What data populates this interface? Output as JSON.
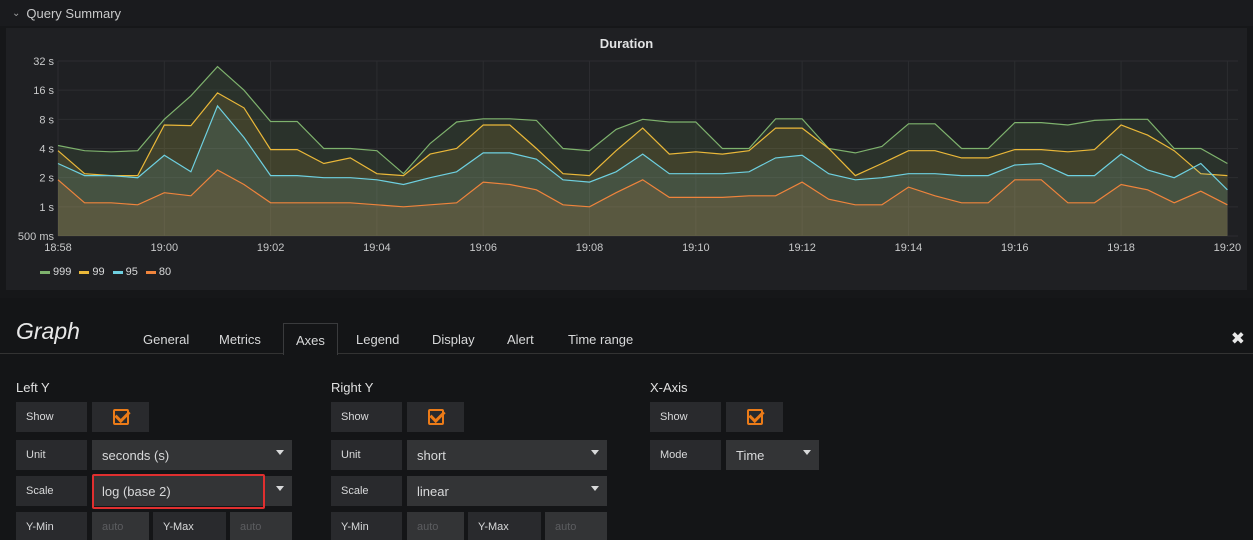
{
  "row": {
    "title": "Query Summary"
  },
  "chart_data": {
    "type": "line",
    "title": "Duration",
    "y_scale": "log2",
    "yticks": [
      "32 s",
      "16 s",
      "8 s",
      "4 s",
      "2 s",
      "1 s",
      "500 ms"
    ],
    "ytick_values": [
      32,
      16,
      8,
      4,
      2,
      1,
      0.5
    ],
    "xticks": [
      "18:58",
      "19:00",
      "19:02",
      "19:04",
      "19:06",
      "19:08",
      "19:10",
      "19:12",
      "19:14",
      "19:16",
      "19:18",
      "19:20"
    ],
    "x_start_min": 0,
    "x_end_min": 22.2,
    "x": [
      0,
      0.5,
      1,
      1.5,
      2,
      2.5,
      3,
      3.5,
      4,
      4.5,
      5,
      5.5,
      6,
      6.5,
      7,
      7.5,
      8,
      8.5,
      9,
      9.5,
      10,
      10.5,
      11,
      11.5,
      12,
      12.5,
      13,
      13.5,
      14,
      14.5,
      15,
      15.5,
      16,
      16.5,
      17,
      17.5,
      18,
      18.5,
      19,
      19.5,
      20,
      20.5,
      21,
      21.5,
      22
    ],
    "series": [
      {
        "name": "999",
        "color": "#7eb26d",
        "values": [
          4.3,
          3.8,
          3.7,
          3.8,
          8,
          14,
          28,
          16,
          7.6,
          7.6,
          4,
          4,
          3.8,
          2.2,
          4.5,
          7.5,
          8.1,
          8.1,
          7.8,
          4,
          3.8,
          6.3,
          8,
          7.5,
          7.5,
          4,
          4,
          8.1,
          8.1,
          4,
          3.6,
          4.2,
          7.2,
          7.2,
          4,
          4,
          7.4,
          7.4,
          7,
          7.8,
          8,
          8,
          4,
          4,
          2.8
        ]
      },
      {
        "name": "99",
        "color": "#eab839",
        "values": [
          3.8,
          2.2,
          2.1,
          2.1,
          7,
          6.9,
          15,
          10.5,
          3.9,
          3.9,
          2.8,
          3.2,
          2.2,
          2.1,
          3.5,
          4,
          7,
          7,
          4,
          2.2,
          2.1,
          3.8,
          6.5,
          3.5,
          3.7,
          3.5,
          3.8,
          6.5,
          6.5,
          4,
          2.1,
          2.8,
          3.8,
          3.8,
          3.2,
          3.2,
          3.9,
          3.9,
          3.7,
          3.9,
          7,
          5.5,
          3.8,
          2.2,
          2.1
        ]
      },
      {
        "name": "95",
        "color": "#6ed0e0",
        "values": [
          2.8,
          2.1,
          2.1,
          2,
          3.4,
          2.3,
          11,
          5.2,
          2.1,
          2.1,
          2,
          2,
          1.9,
          1.7,
          2,
          2.3,
          3.6,
          3.6,
          3.1,
          1.9,
          1.8,
          2.3,
          3.5,
          2.2,
          2.2,
          2.2,
          2.3,
          3.2,
          3.4,
          2.2,
          1.9,
          2,
          2.2,
          2.2,
          2.1,
          2.1,
          2.7,
          2.8,
          2.1,
          2.1,
          3.5,
          2.4,
          2,
          2.8,
          1.5
        ]
      },
      {
        "name": "80",
        "color": "#ef843c",
        "values": [
          1.9,
          1.1,
          1.1,
          1.05,
          1.4,
          1.3,
          2.4,
          1.7,
          1.1,
          1.1,
          1.1,
          1.1,
          1.05,
          1.0,
          1.05,
          1.1,
          1.8,
          1.7,
          1.5,
          1.05,
          1.0,
          1.4,
          1.9,
          1.25,
          1.25,
          1.25,
          1.3,
          1.3,
          1.8,
          1.2,
          1.05,
          1.05,
          1.6,
          1.3,
          1.1,
          1.1,
          1.9,
          1.9,
          1.1,
          1.1,
          1.7,
          1.5,
          1.1,
          1.45,
          1.05
        ]
      }
    ]
  },
  "editor": {
    "panel_type": "Graph",
    "tabs": [
      "General",
      "Metrics",
      "Axes",
      "Legend",
      "Display",
      "Alert",
      "Time range"
    ],
    "active_tab": "Axes",
    "left_y": {
      "title": "Left Y",
      "show_label": "Show",
      "unit_label": "Unit",
      "unit_value": "seconds (s)",
      "scale_label": "Scale",
      "scale_value": "log (base 2)",
      "ymin_label": "Y-Min",
      "ymin_placeholder": "auto",
      "ymax_label": "Y-Max",
      "ymax_placeholder": "auto"
    },
    "right_y": {
      "title": "Right Y",
      "show_label": "Show",
      "unit_label": "Unit",
      "unit_value": "short",
      "scale_label": "Scale",
      "scale_value": "linear",
      "ymin_label": "Y-Min",
      "ymin_placeholder": "auto",
      "ymax_label": "Y-Max",
      "ymax_placeholder": "auto"
    },
    "x_axis": {
      "title": "X-Axis",
      "show_label": "Show",
      "mode_label": "Mode",
      "mode_value": "Time"
    }
  },
  "colors": {
    "accent": "#eb7b18",
    "highlight": "#e02f2f"
  },
  "icons": {
    "collapse": "chevron-down-icon",
    "close": "close-icon",
    "checkbox": "checkbox-checked-icon"
  }
}
